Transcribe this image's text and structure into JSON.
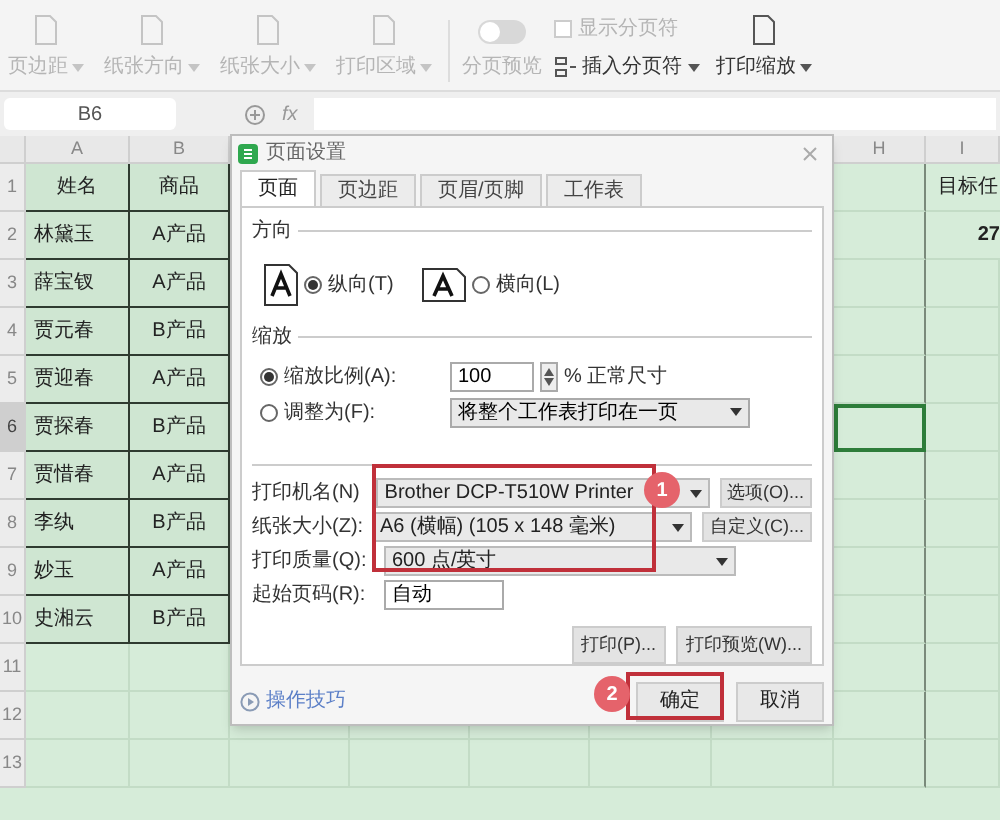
{
  "toolbar": [
    {
      "kind": "button",
      "label": "页边距",
      "disabled": true
    },
    {
      "kind": "button",
      "label": "纸张方向",
      "disabled": true
    },
    {
      "kind": "button",
      "label": "纸张大小",
      "disabled": true
    },
    {
      "kind": "button",
      "label": "打印区域",
      "disabled": true
    },
    {
      "kind": "toggle",
      "label": "分页预览",
      "on": false,
      "disabled": true
    },
    {
      "kind": "checkbox",
      "label": "显示分页符",
      "checked": false,
      "disabled": true
    },
    {
      "kind": "inline",
      "label": "插入分页符",
      "disabled": false
    },
    {
      "kind": "button",
      "label": "打印缩放",
      "disabled": false
    }
  ],
  "formula_bar": {
    "name_box": "B6",
    "function_symbol": "fx"
  },
  "sheet": {
    "columns": [
      "A",
      "B",
      "H",
      "I"
    ],
    "rows": [
      {
        "number": "1",
        "cells": [
          "姓名",
          "商品"
        ],
        "column_i": "目标任",
        "selected": false
      },
      {
        "number": "2",
        "cells": [
          "林黛玉",
          "A产品"
        ],
        "column_i": "27",
        "selected": false
      },
      {
        "number": "3",
        "cells": [
          "薛宝钗",
          "A产品"
        ],
        "selected": false
      },
      {
        "number": "4",
        "cells": [
          "贾元春",
          "B产品"
        ],
        "selected": false
      },
      {
        "number": "5",
        "cells": [
          "贾迎春",
          "A产品"
        ],
        "selected": false
      },
      {
        "number": "6",
        "cells": [
          "贾探春",
          "B产品"
        ],
        "selected": true
      },
      {
        "number": "7",
        "cells": [
          "贾惜春",
          "A产品"
        ],
        "selected": false
      },
      {
        "number": "8",
        "cells": [
          "李纨",
          "B产品"
        ],
        "selected": false
      },
      {
        "number": "9",
        "cells": [
          "妙玉",
          "A产品"
        ],
        "selected": false
      },
      {
        "number": "10",
        "cells": [
          "史湘云",
          "B产品"
        ],
        "selected": false
      },
      {
        "number": "11",
        "selected": false
      },
      {
        "number": "12",
        "selected": false
      },
      {
        "number": "13",
        "selected": false
      }
    ]
  },
  "dialog": {
    "title": "页面设置",
    "tabs": [
      {
        "label": "页面",
        "selected": true
      },
      {
        "label": "页边距",
        "selected": false
      },
      {
        "label": "页眉/页脚",
        "selected": false
      },
      {
        "label": "工作表",
        "selected": false
      }
    ],
    "orientation": {
      "heading": "方向",
      "options": [
        {
          "label": "纵向(T)",
          "selected": true
        },
        {
          "label": "横向(L)",
          "selected": false
        }
      ]
    },
    "scaling": {
      "heading": "缩放",
      "options": [
        {
          "kind": "spin",
          "label": "缩放比例(A):",
          "selected": true,
          "value": "100",
          "suffix": "% 正常尺寸"
        },
        {
          "kind": "dropdown",
          "label": "调整为(F):",
          "selected": false,
          "value": "将整个工作表打印在一页"
        }
      ]
    },
    "fields": [
      {
        "kind": "dropdown",
        "label": "打印机名(N)",
        "value": "Brother DCP-T510W Printer",
        "button": "选项(O)..."
      },
      {
        "kind": "dropdown",
        "label": "纸张大小(Z):",
        "value": "A6 (横幅) (105 x 148 毫米)",
        "button": "自定义(C)..."
      },
      {
        "kind": "dropdown",
        "label": "打印质量(Q):",
        "value": "600 点/英寸"
      },
      {
        "kind": "input",
        "label": "起始页码(R):",
        "value": "自动"
      }
    ],
    "print_buttons": [
      "打印(P)...",
      "打印预览(W)..."
    ],
    "tips_link": "操作技巧",
    "buttons": [
      "确定",
      "取消"
    ]
  },
  "annotations": [
    {
      "label": "1"
    },
    {
      "label": "2"
    }
  ]
}
